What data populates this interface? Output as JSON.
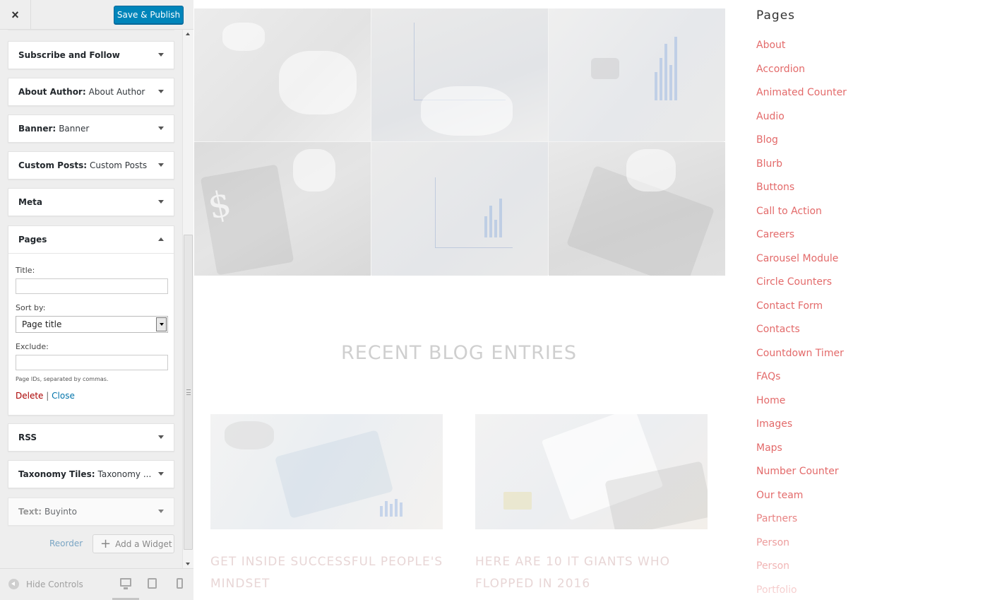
{
  "header": {
    "close_icon": "×",
    "publish_label": "Save & Publish"
  },
  "widgets": [
    {
      "name": "Subscribe and Follow",
      "title": ""
    },
    {
      "name": "About Author:",
      "title": "About Author"
    },
    {
      "name": "Banner:",
      "title": "Banner"
    },
    {
      "name": "Custom Posts:",
      "title": "Custom Posts"
    },
    {
      "name": "Meta",
      "title": ""
    },
    {
      "name": "Pages",
      "title": ""
    },
    {
      "name": "RSS",
      "title": ""
    },
    {
      "name": "Taxonomy Tiles:",
      "title": "Taxonomy ..."
    },
    {
      "name": "Text:",
      "title": "Buyinto"
    }
  ],
  "pages_form": {
    "title_label": "Title:",
    "title_value": "",
    "sort_label": "Sort by:",
    "sort_value": "Page title",
    "exclude_label": "Exclude:",
    "exclude_value": "",
    "hint": "Page IDs, separated by commas.",
    "delete_label": "Delete",
    "separator": "|",
    "close_label": "Close"
  },
  "sidebar_actions": {
    "reorder_label": "Reorder",
    "add_widget_icon": "+",
    "add_widget_label": "Add a Widget"
  },
  "footer": {
    "hide_controls_label": "Hide Controls",
    "devices": [
      "desktop-icon",
      "tablet-icon",
      "mobile-icon"
    ]
  },
  "preview": {
    "section_title": "RECENT BLOG ENTRIES",
    "posts": [
      {
        "title": "GET INSIDE SUCCESSFUL PEOPLE'S MINDSET"
      },
      {
        "title": "HERE ARE 10 IT GIANTS WHO FLOPPED IN 2016"
      }
    ],
    "sidebar_widget_title": "Pages",
    "pages": [
      "About",
      "Accordion",
      "Animated Counter",
      "Audio",
      "Blog",
      "Blurb",
      "Buttons",
      "Call to Action",
      "Careers",
      "Carousel Module",
      "Circle Counters",
      "Contact Form",
      "Contacts",
      "Countdown Timer",
      "FAQs",
      "Home",
      "Images",
      "Maps",
      "Number Counter",
      "Our team",
      "Partners",
      "Person",
      "Person",
      "Portfolio"
    ]
  },
  "colors": {
    "publish_button": "#0085ba",
    "page_link": "#e36a6a",
    "delete_link": "#aa0000",
    "close_link": "#0073aa"
  }
}
